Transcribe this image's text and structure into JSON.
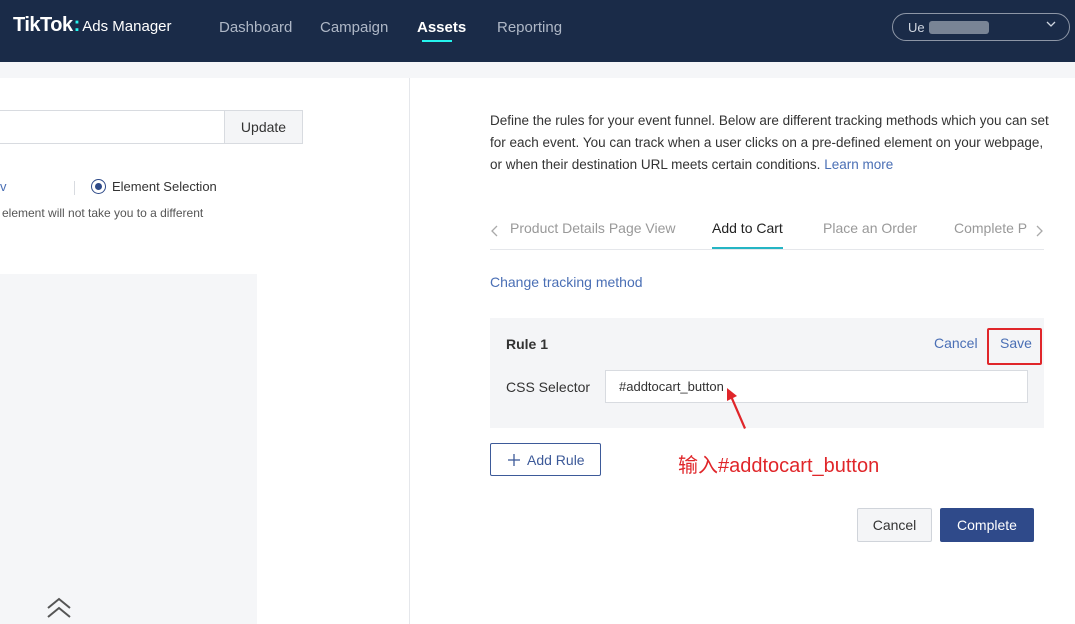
{
  "header": {
    "logo_main": "TikTok",
    "logo_colon": ":",
    "logo_sub": "Ads Manager",
    "nav": [
      {
        "label": "Dashboard"
      },
      {
        "label": "Campaign"
      },
      {
        "label": "Assets"
      },
      {
        "label": "Reporting"
      }
    ],
    "active_nav": "Assets",
    "account_prefix": "Ue"
  },
  "left": {
    "update_label": "Update",
    "method_partial": "v",
    "element_selection_label": "Element Selection",
    "element_selection_checked": true,
    "hint_text": "element will not take you to a different"
  },
  "right": {
    "description": "Define the rules for your event funnel. Below are different tracking methods which you can set for each event. You can track when a user clicks on a pre-defined element on your webpage, or when their destination URL meets certain conditions.",
    "learn_more": "Learn more",
    "tabs": [
      {
        "label": "Product Details Page View"
      },
      {
        "label": "Add to Cart"
      },
      {
        "label": "Place an Order"
      },
      {
        "label": "Complete P"
      }
    ],
    "active_tab": "Add to Cart",
    "change_tracking": "Change tracking method",
    "rule": {
      "title": "Rule 1",
      "cancel": "Cancel",
      "save": "Save",
      "css_label": "CSS Selector",
      "css_value": "#addtocart_button"
    },
    "annotation": "输入#addtocart_button",
    "add_rule": "Add Rule",
    "cancel": "Cancel",
    "complete": "Complete"
  },
  "colors": {
    "topbar": "#1a2b48",
    "accent": "#25f4ee",
    "link": "#4a6fb5",
    "primary": "#2f4a8a",
    "annotation": "#e0262a"
  }
}
